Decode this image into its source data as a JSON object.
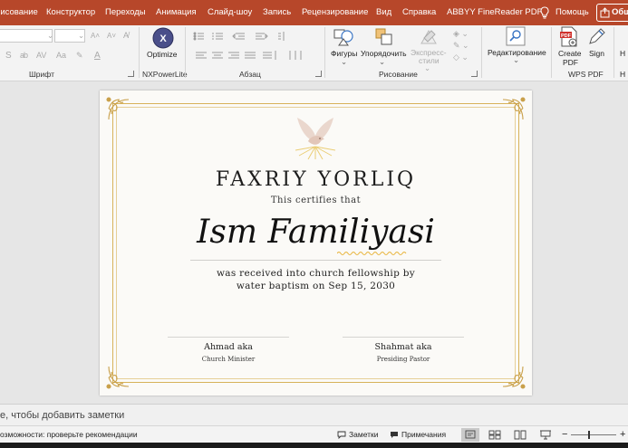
{
  "menu": {
    "tabs": [
      "Рисование",
      "Конструктор",
      "Переходы",
      "Анимация",
      "Слайд-шоу",
      "Запись",
      "Рецензирование",
      "Вид",
      "Справка",
      "ABBYY FineReader PDF"
    ],
    "help_search": "Помощь",
    "share": "Общий доступ"
  },
  "ribbon": {
    "groups": {
      "font": "Шрифт",
      "nxpowerlite": "NXPowerLite",
      "paragraph": "Абзац",
      "drawing": "Рисование",
      "wps_pdf": "WPS PDF"
    },
    "buttons": {
      "optimize": "Optimize",
      "shapes": "Фигуры",
      "arrange": "Упорядочить",
      "quick_styles_1": "Экспресс-",
      "quick_styles_2": "стили",
      "editing": "Редактирование",
      "create_pdf_1": "Create",
      "create_pdf_2": "PDF",
      "sign": "Sign",
      "overflow": "Н"
    }
  },
  "slide": {
    "title": "FAXRIY YORLIQ",
    "certifies": "This certifies that",
    "name": "Ism Familiyasi",
    "body_line1": "was received into church fellowship by",
    "body_line2": "water baptism on Sep 15, 2030",
    "signers": [
      {
        "name": "Ahmad aka",
        "role": "Church Minister"
      },
      {
        "name": "Shahmat aka",
        "role": "Presiding Pastor"
      }
    ],
    "accent_color": "#d4ab4c"
  },
  "notes": {
    "placeholder": "е, чтобы добавить заметки"
  },
  "status": {
    "accessibility": "озможности: проверьте рекомендации",
    "notes_btn": "Заметки",
    "comments_btn": "Примечания"
  },
  "colors": {
    "menubar": "#b7472a",
    "ribbon": "#f3f3f3"
  }
}
